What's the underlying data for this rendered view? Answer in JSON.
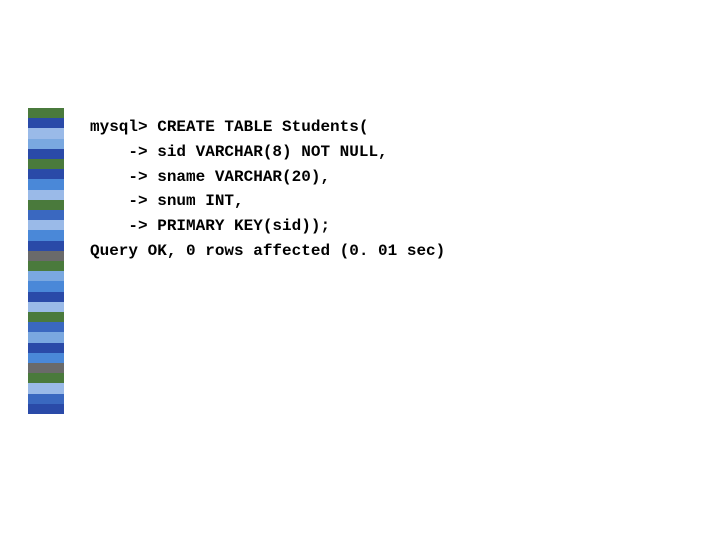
{
  "stripes": [
    "#4a7a3c",
    "#2a4aa8",
    "#9abae8",
    "#7aa8e0",
    "#2a4aa8",
    "#4a7a3c",
    "#2a4aa8",
    "#4a88d8",
    "#9abae8",
    "#4a7a3c",
    "#3a68c0",
    "#9abae8",
    "#4a88d8",
    "#2a4aa8",
    "#6a6a6a",
    "#4a7a3c",
    "#7aa8e0",
    "#4a88d8",
    "#2a4aa8",
    "#9abae8",
    "#4a7a3c",
    "#3a68c0",
    "#7aa8e0",
    "#2a4aa8",
    "#4a88d8",
    "#6a6a6a",
    "#4a7a3c",
    "#9abae8",
    "#3a68c0",
    "#2a4aa8"
  ],
  "code": {
    "line1": "mysql> CREATE TABLE Students(",
    "line2": "    -> sid VARCHAR(8) NOT NULL,",
    "line3": "    -> sname VARCHAR(20),",
    "line4": "    -> snum INT,",
    "line5": "    -> PRIMARY KEY(sid));",
    "line6": "Query OK, 0 rows affected (0. 01 sec)"
  }
}
